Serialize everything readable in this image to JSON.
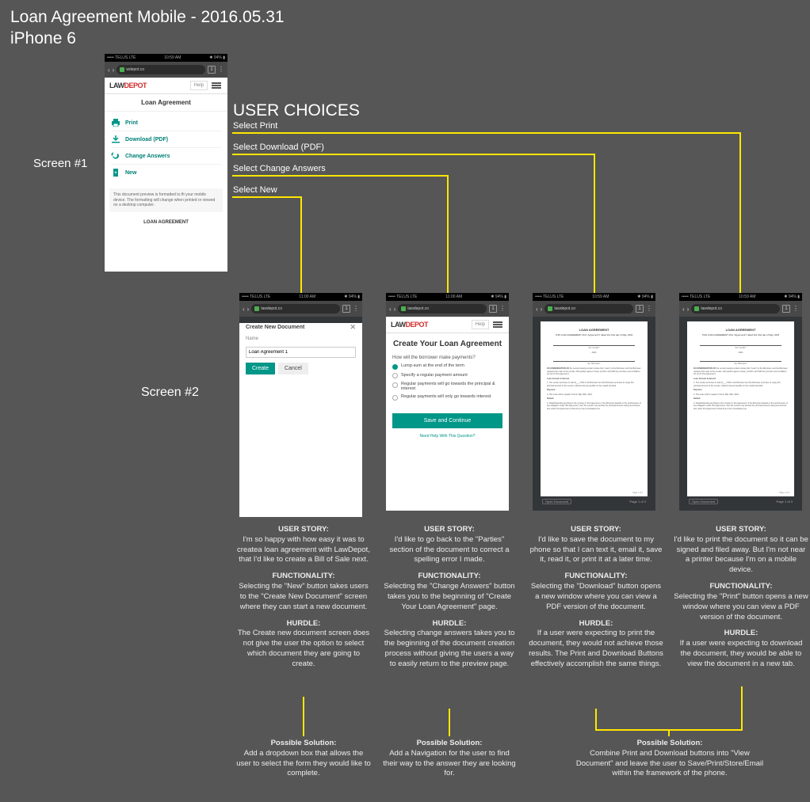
{
  "header": {
    "title": "Loan Agreement Mobile - 2016.05.31",
    "device": "iPhone 6"
  },
  "labels": {
    "screen1": "Screen #1",
    "screen2": "Screen #2",
    "choices_title": "USER CHOICES",
    "choice_print": "Select Print",
    "choice_download": "Select Download (PDF)",
    "choice_change": "Select Change Answers",
    "choice_new": "Select New"
  },
  "status_bar": {
    "carrier": "TELUS LTE",
    "time1": "10:59 AM",
    "time2": "11:00 AM",
    "battery": "94%"
  },
  "browser": {
    "url_short": "wdepot.co",
    "url_long": "lawdepot.co",
    "tab_count": "1"
  },
  "screen1": {
    "logo_law": "LAW",
    "logo_depot": "DEPOT",
    "help": "Help",
    "page_title": "Loan Agreement",
    "menu": {
      "print": "Print",
      "download": "Download (PDF)",
      "change": "Change Answers",
      "new": "New"
    },
    "disclaimer": "This document preview is formatted to fit your mobile device. The formatting will change when printed or viewed on a desktop computer.",
    "doc_title": "LOAN AGREEMENT"
  },
  "modal": {
    "title": "Create New Document",
    "name_label": "Name",
    "name_value": "Loan Agreement 1",
    "create": "Create",
    "cancel": "Cancel"
  },
  "wizard": {
    "title": "Create Your Loan Agreement",
    "question": "How will the borrower make payments?",
    "opt1": "Lump-sum at the end of the term",
    "opt2": "Specify a regular payment amount",
    "opt3": "Regular payments will go towards the principal & interest",
    "opt4": "Regular payments will only go towards interest",
    "save": "Save and Continue",
    "help": "Need Help With This Question?"
  },
  "pdf": {
    "doc_title": "LOAN AGREEMENT",
    "subtitle": "THIS LOAN AGREEMENT (this \"Agreement\") dated this 31st day of May, 2016",
    "lender": "the \"Lender\"",
    "borrower": "the \"Borrower\"",
    "footer_open": "Open Document",
    "page": "Page 1 of 3"
  },
  "annotations": {
    "new": {
      "story_title": "USER STORY:",
      "story": "I'm so happy with how easy it was to createa loan agreement with LawDepot, that I'd like to create a Bill of Sale next.",
      "func_title": "FUNCTIONALITY:",
      "func": "Selecting the \"New\" button takes users to the \"Create New Document\" screen where they can start a new document.",
      "hurdle_title": "HURDLE:",
      "hurdle": "The Create new document screen does not give the user the option to select which document they are going to create."
    },
    "change": {
      "story_title": "USER STORY:",
      "story": "I'd like to go back to the \"Parties\" section of the document to correct a spelling error I made.",
      "func_title": "FUNCTIONALITY:",
      "func": "Selecting the \"Change Answers\" button takes you to the beginning of \"Create Your Loan Agreement\" page.",
      "hurdle_title": "HURDLE:",
      "hurdle": "Selecting change answers takes you to the beginning of the document creation process without giving the users a way to easily return to the preview page."
    },
    "download": {
      "story_title": "USER STORY:",
      "story": "I'd like to save the document to my phone so that I can text it, email it, save it, read it, or print it at a later time.",
      "func_title": "FUNCTIONALITY:",
      "func": "Selecting the \"Download\" button opens a new window where you can view a PDF version of the document.",
      "hurdle_title": "HURDLE:",
      "hurdle": "If a user were expecting to print the document, they would not achieve those results. The Print and Download Buttons effectively accomplish the same things."
    },
    "print": {
      "story_title": "USER STORY:",
      "story": "I'd like to print the document so it can be signed and filed away. But I'm not near a printer because I'm on a mobile device.",
      "func_title": "FUNCTIONALITY:",
      "func": "Selecting the \"Print\" button opens a new window where you can view a PDF version of the document.",
      "hurdle_title": "HURDLE:",
      "hurdle": "If a user were expecting to download the document, they would be able to view the document in a new tab."
    }
  },
  "solutions": {
    "new": {
      "title": "Possible Solution:",
      "body": "Add a dropdown box that allows the user to select the form they would like to complete."
    },
    "change": {
      "title": "Possible Solution:",
      "body": "Add a Navigation for the user to find their way to the answer they are looking for."
    },
    "combined": {
      "title": "Possible Solution:",
      "body": "Combine Print and Download buttons into \"View Document\" and leave the user to Save/Print/Store/Email within the framework of the phone."
    }
  }
}
